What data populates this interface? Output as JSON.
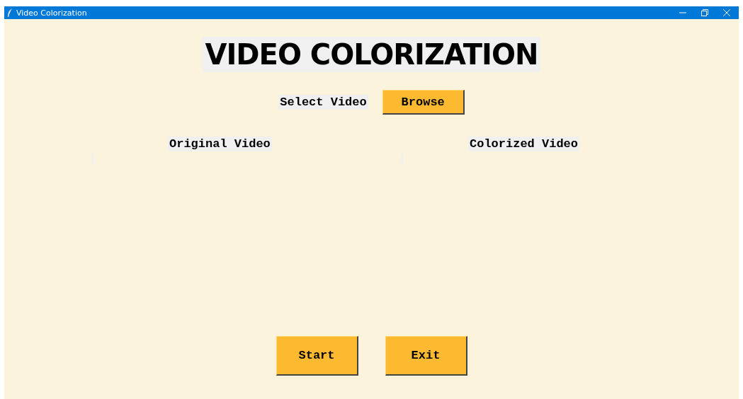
{
  "window": {
    "title": "Video Colorization"
  },
  "heading": "VIDEO COLORIZATION",
  "select": {
    "label": "Select Video",
    "button": "Browse"
  },
  "panels": [
    {
      "label": "Original Video"
    },
    {
      "label": "Colorized Video"
    }
  ],
  "buttons": [
    "Start",
    "Exit"
  ]
}
